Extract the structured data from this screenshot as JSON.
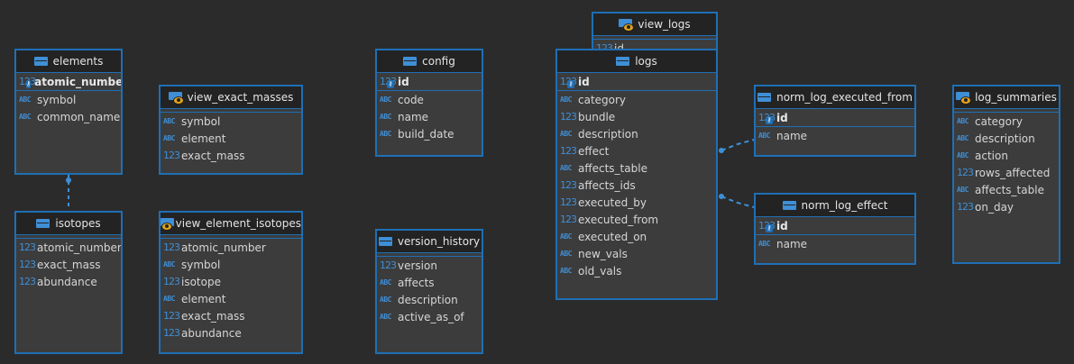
{
  "colors": {
    "background": "#2b2b2b",
    "entity_fill": "#3c3c3c",
    "border": "#1f6fb5",
    "header": "#232323",
    "type_icon": "#3f8fd6",
    "view_eye": "#e3a21a"
  },
  "entities": {
    "elements": {
      "title": "elements",
      "kind": "table",
      "pk": [
        {
          "type": "123",
          "name": "atomic_number"
        }
      ],
      "columns": [
        {
          "type": "ABC",
          "name": "symbol"
        },
        {
          "type": "ABC",
          "name": "common_name"
        }
      ]
    },
    "isotopes": {
      "title": "isotopes",
      "kind": "table",
      "pk": [],
      "columns": [
        {
          "type": "123",
          "name": "atomic_number"
        },
        {
          "type": "123",
          "name": "exact_mass"
        },
        {
          "type": "123",
          "name": "abundance"
        }
      ]
    },
    "view_exact_masses": {
      "title": "view_exact_masses",
      "kind": "view",
      "pk": [],
      "columns": [
        {
          "type": "ABC",
          "name": "symbol"
        },
        {
          "type": "ABC",
          "name": "element"
        },
        {
          "type": "123",
          "name": "exact_mass"
        }
      ]
    },
    "view_element_isotopes": {
      "title": "view_element_isotopes",
      "kind": "view",
      "pk": [],
      "columns": [
        {
          "type": "123",
          "name": "atomic_number"
        },
        {
          "type": "ABC",
          "name": "symbol"
        },
        {
          "type": "123",
          "name": "isotope"
        },
        {
          "type": "ABC",
          "name": "element"
        },
        {
          "type": "123",
          "name": "exact_mass"
        },
        {
          "type": "123",
          "name": "abundance"
        }
      ]
    },
    "config": {
      "title": "config",
      "kind": "table",
      "pk": [
        {
          "type": "123",
          "name": "id"
        }
      ],
      "columns": [
        {
          "type": "ABC",
          "name": "code"
        },
        {
          "type": "ABC",
          "name": "name"
        },
        {
          "type": "ABC",
          "name": "build_date"
        }
      ]
    },
    "version_history": {
      "title": "version_history",
      "kind": "table",
      "pk": [],
      "columns": [
        {
          "type": "123",
          "name": "version"
        },
        {
          "type": "ABC",
          "name": "affects"
        },
        {
          "type": "ABC",
          "name": "description"
        },
        {
          "type": "ABC",
          "name": "active_as_of"
        }
      ]
    },
    "view_logs": {
      "title": "view_logs",
      "kind": "view",
      "pk": [],
      "columns": [
        {
          "type": "123",
          "name": "id"
        }
      ]
    },
    "logs": {
      "title": "logs",
      "kind": "table",
      "pk": [
        {
          "type": "123",
          "name": "id"
        }
      ],
      "columns": [
        {
          "type": "ABC",
          "name": "category"
        },
        {
          "type": "123",
          "name": "bundle"
        },
        {
          "type": "ABC",
          "name": "description"
        },
        {
          "type": "123",
          "name": "effect"
        },
        {
          "type": "ABC",
          "name": "affects_table"
        },
        {
          "type": "123",
          "name": "affects_ids"
        },
        {
          "type": "123",
          "name": "executed_by"
        },
        {
          "type": "123",
          "name": "executed_from"
        },
        {
          "type": "ABC",
          "name": "executed_on"
        },
        {
          "type": "ABC",
          "name": "new_vals"
        },
        {
          "type": "ABC",
          "name": "old_vals"
        }
      ]
    },
    "norm_log_executed_from": {
      "title": "norm_log_executed_from",
      "kind": "table",
      "pk": [
        {
          "type": "123",
          "name": "id"
        }
      ],
      "columns": [
        {
          "type": "ABC",
          "name": "name"
        }
      ]
    },
    "norm_log_effect": {
      "title": "norm_log_effect",
      "kind": "table",
      "pk": [
        {
          "type": "123",
          "name": "id"
        }
      ],
      "columns": [
        {
          "type": "ABC",
          "name": "name"
        }
      ]
    },
    "log_summaries": {
      "title": "log_summaries",
      "kind": "view",
      "pk": [],
      "columns": [
        {
          "type": "ABC",
          "name": "category"
        },
        {
          "type": "ABC",
          "name": "description"
        },
        {
          "type": "ABC",
          "name": "action"
        },
        {
          "type": "123",
          "name": "rows_affected"
        },
        {
          "type": "ABC",
          "name": "affects_table"
        },
        {
          "type": "123",
          "name": "on_day"
        }
      ]
    }
  },
  "relationships": [
    {
      "from": "elements",
      "to": "isotopes"
    },
    {
      "from": "logs",
      "to": "norm_log_executed_from"
    },
    {
      "from": "logs",
      "to": "norm_log_effect"
    }
  ]
}
